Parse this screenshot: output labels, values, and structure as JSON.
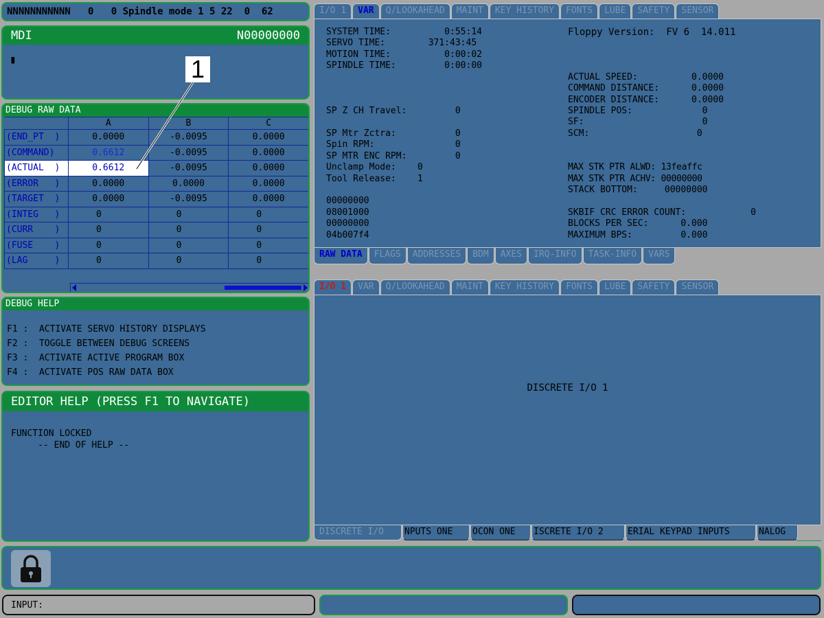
{
  "header": {
    "status_line": "NNNNNNNNNNN   0   0 Spindle mode 1 5 22  0  62"
  },
  "mdi": {
    "title": "MDI",
    "program_number": "N00000000",
    "cursor": "▮"
  },
  "callout": {
    "label": "1"
  },
  "debug_raw": {
    "title": "DEBUG RAW DATA",
    "columns": [
      "A",
      "B",
      "C"
    ],
    "rows": [
      {
        "label": "(END_PT  )",
        "a": "0.0000",
        "b": "-0.0095",
        "c": "0.0000"
      },
      {
        "label": "(COMMAND)",
        "a": "0.6612",
        "b": "-0.0095",
        "c": "0.0000"
      },
      {
        "label": "(ACTUAL  )",
        "a": "0.6612",
        "b": "-0.0095",
        "c": "0.0000"
      },
      {
        "label": "(ERROR   )",
        "a": "0.0000",
        "b": "0.0000",
        "c": "0.0000"
      },
      {
        "label": "(TARGET  )",
        "a": "0.0000",
        "b": "-0.0095",
        "c": "0.0000"
      },
      {
        "label": "(INTEG   )",
        "a": "0",
        "b": "0",
        "c": "0"
      },
      {
        "label": "(CURR    )",
        "a": "0",
        "b": "0",
        "c": "0"
      },
      {
        "label": "(FUSE    )",
        "a": "0",
        "b": "0",
        "c": "0"
      },
      {
        "label": "(LAG     )",
        "a": "0",
        "b": "0",
        "c": "0"
      }
    ]
  },
  "debug_help": {
    "title": "DEBUG HELP",
    "lines": [
      "F1 :  ACTIVATE SERVO HISTORY DISPLAYS",
      "F2 :  TOGGLE BETWEEN DEBUG SCREENS",
      "F3 :  ACTIVATE ACTIVE PROGRAM BOX",
      "F4 :  ACTIVATE POS RAW DATA BOX"
    ]
  },
  "editor_help": {
    "title": "EDITOR HELP (PRESS F1 TO NAVIGATE)",
    "line1": "FUNCTION LOCKED",
    "line2": "     -- END OF HELP --"
  },
  "top_tabs": [
    "I/O 1",
    "VAR",
    "Q/LOOKAHEAD",
    "MAINT",
    "KEY HISTORY",
    "FONTS",
    "LUBE",
    "SAFETY",
    "SENSOR"
  ],
  "var_panel": {
    "left_lines": [
      "SYSTEM TIME:          0:55:14",
      "SERVO TIME:        371:43:45",
      "MOTION TIME:          0:00:02",
      "SPINDLE TIME:         0:00:00"
    ],
    "sp_lines": [
      "SP Z CH Travel:         0",
      "",
      "SP Mtr Zctra:           0",
      "Spin RPM:               0",
      "SP MTR ENC RPM:         0",
      "Unclamp Mode:    0",
      "Tool Release:    1"
    ],
    "hex_lines": [
      "00000000",
      "08001000",
      "00000000",
      "04b007f4"
    ],
    "floppy": "Floppy Version:  FV 6  14.011",
    "right_lines": [
      "ACTUAL SPEED:          0.0000",
      "COMMAND DISTANCE:      0.0000",
      "ENCODER DISTANCE:      0.0000",
      "SPINDLE POS:             0",
      "SF:                      0",
      "SCM:                    0"
    ],
    "stk_lines": [
      "MAX STK PTR ALWD: 13feaffc",
      "MAX STK PTR ACHV: 00000000",
      "STACK BOTTOM:     00000000"
    ],
    "crc_lines": [
      "SKBIF CRC ERROR COUNT:            0",
      "BLOCKS PER SEC:      0.000",
      "MAXIMUM BPS:         0.000"
    ]
  },
  "var_bottom_tabs": [
    "RAW DATA",
    "FLAGS",
    "ADDRESSES",
    "BDM",
    "AXES",
    "IRQ-INFO",
    "TASK-INFO",
    "VARS"
  ],
  "io_tabs": [
    "I/O 1",
    "VAR",
    "Q/LOOKAHEAD",
    "MAINT",
    "KEY HISTORY",
    "FONTS",
    "LUBE",
    "SAFETY",
    "SENSOR"
  ],
  "io_panel": {
    "center_text": "DISCRETE I/O 1"
  },
  "io_bottom_tabs": [
    "DISCRETE I/O",
    "NPUTS ONE",
    "OCON ONE",
    "ISCRETE I/O 2",
    "ERIAL KEYPAD INPUTS",
    "NALOG"
  ],
  "input_bar": {
    "label": "INPUT:"
  },
  "icons": {
    "lock": "lock-icon"
  }
}
